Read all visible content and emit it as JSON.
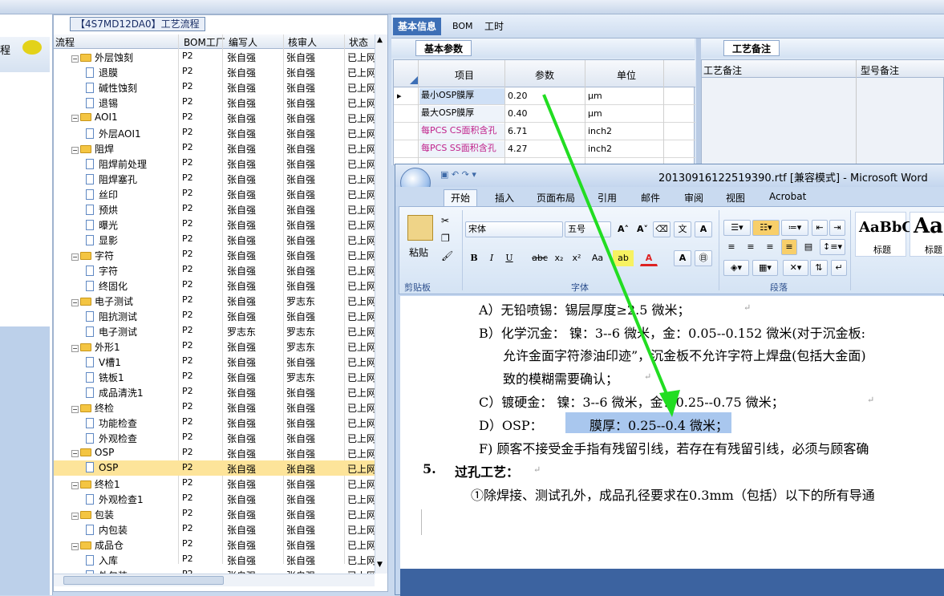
{
  "left_panel": {
    "partial_label": "程"
  },
  "tree": {
    "title": "【4S7MD12DA0】工艺流程",
    "columns": [
      "流程",
      "BOM工厂",
      "编写人",
      "核审人",
      "状态"
    ],
    "rows": [
      {
        "level": 1,
        "kind": "folder",
        "name": "外层蚀刻",
        "factory": "P2",
        "writer": "张自强",
        "reviewer": "张自强",
        "status": "已上网"
      },
      {
        "level": 2,
        "kind": "doc",
        "name": "退膜",
        "factory": "P2",
        "writer": "张自强",
        "reviewer": "张自强",
        "status": "已上网"
      },
      {
        "level": 2,
        "kind": "doc",
        "name": "碱性蚀刻",
        "factory": "P2",
        "writer": "张自强",
        "reviewer": "张自强",
        "status": "已上网"
      },
      {
        "level": 2,
        "kind": "doc",
        "name": "退锡",
        "factory": "P2",
        "writer": "张自强",
        "reviewer": "张自强",
        "status": "已上网"
      },
      {
        "level": 1,
        "kind": "folder",
        "name": "AOI1",
        "factory": "P2",
        "writer": "张自强",
        "reviewer": "张自强",
        "status": "已上网"
      },
      {
        "level": 2,
        "kind": "doc",
        "name": "外层AOI1",
        "factory": "P2",
        "writer": "张自强",
        "reviewer": "张自强",
        "status": "已上网"
      },
      {
        "level": 1,
        "kind": "folder",
        "name": "阻焊",
        "factory": "P2",
        "writer": "张自强",
        "reviewer": "张自强",
        "status": "已上网"
      },
      {
        "level": 2,
        "kind": "doc",
        "name": "阻焊前处理",
        "factory": "P2",
        "writer": "张自强",
        "reviewer": "张自强",
        "status": "已上网"
      },
      {
        "level": 2,
        "kind": "doc",
        "name": "阻焊塞孔",
        "factory": "P2",
        "writer": "张自强",
        "reviewer": "张自强",
        "status": "已上网"
      },
      {
        "level": 2,
        "kind": "doc",
        "name": "丝印",
        "factory": "P2",
        "writer": "张自强",
        "reviewer": "张自强",
        "status": "已上网"
      },
      {
        "level": 2,
        "kind": "doc",
        "name": "预烘",
        "factory": "P2",
        "writer": "张自强",
        "reviewer": "张自强",
        "status": "已上网"
      },
      {
        "level": 2,
        "kind": "doc",
        "name": "曝光",
        "factory": "P2",
        "writer": "张自强",
        "reviewer": "张自强",
        "status": "已上网"
      },
      {
        "level": 2,
        "kind": "doc",
        "name": "显影",
        "factory": "P2",
        "writer": "张自强",
        "reviewer": "张自强",
        "status": "已上网"
      },
      {
        "level": 1,
        "kind": "folder",
        "name": "字符",
        "factory": "P2",
        "writer": "张自强",
        "reviewer": "张自强",
        "status": "已上网"
      },
      {
        "level": 2,
        "kind": "doc",
        "name": "字符",
        "factory": "P2",
        "writer": "张自强",
        "reviewer": "张自强",
        "status": "已上网"
      },
      {
        "level": 2,
        "kind": "doc",
        "name": "终固化",
        "factory": "P2",
        "writer": "张自强",
        "reviewer": "张自强",
        "status": "已上网"
      },
      {
        "level": 1,
        "kind": "folder",
        "name": "电子测试",
        "factory": "P2",
        "writer": "张自强",
        "reviewer": "罗志东",
        "status": "已上网"
      },
      {
        "level": 2,
        "kind": "doc",
        "name": "阻抗测试",
        "factory": "P2",
        "writer": "张自强",
        "reviewer": "张自强",
        "status": "已上网"
      },
      {
        "level": 2,
        "kind": "doc",
        "name": "电子测试",
        "factory": "P2",
        "writer": "罗志东",
        "reviewer": "罗志东",
        "status": "已上网"
      },
      {
        "level": 1,
        "kind": "folder",
        "name": "外形1",
        "factory": "P2",
        "writer": "张自强",
        "reviewer": "罗志东",
        "status": "已上网"
      },
      {
        "level": 2,
        "kind": "doc",
        "name": "V槽1",
        "factory": "P2",
        "writer": "张自强",
        "reviewer": "张自强",
        "status": "已上网"
      },
      {
        "level": 2,
        "kind": "doc",
        "name": "铣板1",
        "factory": "P2",
        "writer": "张自强",
        "reviewer": "罗志东",
        "status": "已上网"
      },
      {
        "level": 2,
        "kind": "doc",
        "name": "成品清洗1",
        "factory": "P2",
        "writer": "张自强",
        "reviewer": "张自强",
        "status": "已上网"
      },
      {
        "level": 1,
        "kind": "folder",
        "name": "终检",
        "factory": "P2",
        "writer": "张自强",
        "reviewer": "张自强",
        "status": "已上网"
      },
      {
        "level": 2,
        "kind": "doc",
        "name": "功能检查",
        "factory": "P2",
        "writer": "张自强",
        "reviewer": "张自强",
        "status": "已上网"
      },
      {
        "level": 2,
        "kind": "doc",
        "name": "外观检查",
        "factory": "P2",
        "writer": "张自强",
        "reviewer": "张自强",
        "status": "已上网"
      },
      {
        "level": 1,
        "kind": "folder",
        "name": "OSP",
        "factory": "P2",
        "writer": "张自强",
        "reviewer": "张自强",
        "status": "已上网"
      },
      {
        "level": 2,
        "kind": "doc",
        "name": "OSP",
        "factory": "P2",
        "writer": "张自强",
        "reviewer": "张自强",
        "status": "已上网",
        "selected": true
      },
      {
        "level": 1,
        "kind": "folder",
        "name": "终检1",
        "factory": "P2",
        "writer": "张自强",
        "reviewer": "张自强",
        "status": "已上网"
      },
      {
        "level": 2,
        "kind": "doc",
        "name": "外观检查1",
        "factory": "P2",
        "writer": "张自强",
        "reviewer": "张自强",
        "status": "已上网"
      },
      {
        "level": 1,
        "kind": "folder",
        "name": "包装",
        "factory": "P2",
        "writer": "张自强",
        "reviewer": "张自强",
        "status": "已上网"
      },
      {
        "level": 2,
        "kind": "doc",
        "name": "内包装",
        "factory": "P2",
        "writer": "张自强",
        "reviewer": "张自强",
        "status": "已上网"
      },
      {
        "level": 1,
        "kind": "folder",
        "name": "成品仓",
        "factory": "P2",
        "writer": "张自强",
        "reviewer": "张自强",
        "status": "已上网"
      },
      {
        "level": 2,
        "kind": "doc",
        "name": "入库",
        "factory": "P2",
        "writer": "张自强",
        "reviewer": "张自强",
        "status": "已上网"
      },
      {
        "level": 2,
        "kind": "doc",
        "name": "外包装",
        "factory": "P2",
        "writer": "张自强",
        "reviewer": "张自强",
        "status": "已上网"
      }
    ]
  },
  "right_top": {
    "tabs": [
      "基本信息",
      "BOM",
      "工时"
    ],
    "active_tab": "基本信息",
    "basic_tab": "基本参数",
    "grid_columns": [
      "项目",
      "参数",
      "单位"
    ],
    "grid_rows": [
      {
        "item": "最小OSP膜厚",
        "value": "0.20",
        "unit": "μm",
        "pink": false
      },
      {
        "item": "最大OSP膜厚",
        "value": "0.40",
        "unit": "μm",
        "pink": false
      },
      {
        "item": "每PCS CS面积含孔",
        "value": "6.71",
        "unit": "inch2",
        "pink": true
      },
      {
        "item": "每PCS SS面积含孔",
        "value": "4.27",
        "unit": "inch2",
        "pink": true
      }
    ],
    "remark_tab": "工艺备注",
    "remark_columns": [
      "工艺备注",
      "型号备注"
    ]
  },
  "word": {
    "title": "20130916122519390.rtf [兼容模式] - Microsoft Word",
    "ribbon_tabs": [
      "开始",
      "插入",
      "页面布局",
      "引用",
      "邮件",
      "审阅",
      "视图",
      "Acrobat"
    ],
    "active_ribbon_tab": "开始",
    "paste_label": "粘贴",
    "font_name": "宋体",
    "font_size": "五号",
    "group_labels": {
      "clipboard": "剪贴板",
      "font": "字体",
      "paragraph": "段落"
    },
    "styles": [
      {
        "preview": "AaBbC",
        "label": "标题"
      },
      {
        "preview": "Aa",
        "label": "标题"
      }
    ],
    "doc_lines": [
      "A）无铅喷锡：锡层厚度≥2.5 微米；",
      "B）化学沉金：  镍：3--6 微米，金：0.05--0.152 微米(对于沉金板:",
      "允许金面字符渗油印迹”，沉金板不允许字符上焊盘(包括大金面)",
      "致的模糊需要确认；",
      "C）镀硬金：    镍：3--6 微米，金：0.25--0.75 微米；",
      "D）OSP：",
      "膜厚：0.25--0.4 微米；",
      "F) 顾客不接受金手指有残留引线，若存在有残留引线，必须与顾客确",
      "5.",
      "过孔工艺：",
      "①除焊接、测试孔外，成品孔径要求在0.3mm（包括）以下的所有导通"
    ]
  },
  "colors": {
    "arrow": "#22dd22",
    "selected_row": "#fde49a",
    "highlight": "#a9c7ee",
    "pink_text": "#c0218a"
  }
}
